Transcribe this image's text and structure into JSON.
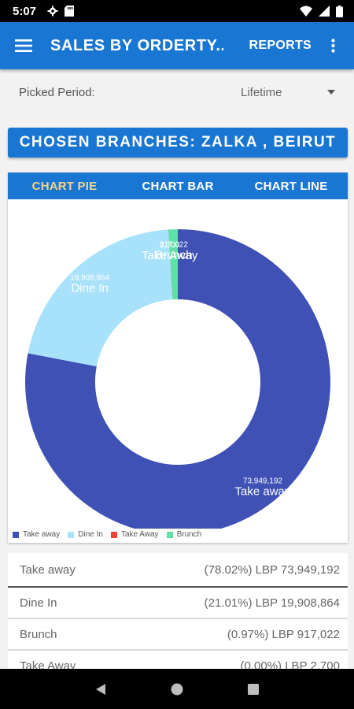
{
  "status_bar": {
    "time": "5:07"
  },
  "app_bar": {
    "title": "SALES BY ORDERTY...",
    "reports_label": "REPORTS"
  },
  "period": {
    "label": "Picked Period:",
    "value": "Lifetime"
  },
  "branches_banner": "CHOSEN BRANCHES: ZALKA , BEIRUT",
  "tabs": [
    {
      "label": "CHART PIE",
      "active": true
    },
    {
      "label": "CHART BAR",
      "active": false
    },
    {
      "label": "CHART LINE",
      "active": false
    }
  ],
  "colors": {
    "primary": "#1976d2",
    "active_tab": "#f5d48a",
    "take_away_lower": "#3f51b5",
    "dine_in": "#a8e1fa",
    "take_away_upper": "#f44336",
    "brunch": "#5fe0a6"
  },
  "chart_data": {
    "type": "pie",
    "donut": true,
    "slices": [
      {
        "name": "Take away",
        "value": 73949192,
        "value_text": "73,949,192",
        "color": "#3f51b5"
      },
      {
        "name": "Dine In",
        "value": 19908864,
        "value_text": "19,908,864",
        "color": "#a8e1fa"
      },
      {
        "name": "Take Away",
        "value": 2700,
        "value_text": "2,700",
        "color": "#f44336"
      },
      {
        "name": "Brunch",
        "value": 917022,
        "value_text": "917,022",
        "color": "#5fe0a6"
      }
    ],
    "legend": [
      "Take away",
      "Dine In",
      "Take Away",
      "Brunch"
    ],
    "legend_position": "bottom-left"
  },
  "list": [
    {
      "name": "Take away",
      "amount": "(78.02%) LBP 73,949,192"
    },
    {
      "name": "Dine In",
      "amount": "(21.01%) LBP 19,908,864"
    },
    {
      "name": "Brunch",
      "amount": "(0.97%) LBP 917,022"
    },
    {
      "name": "Take Away",
      "amount": "(0.00%) LBP 2,700"
    }
  ]
}
